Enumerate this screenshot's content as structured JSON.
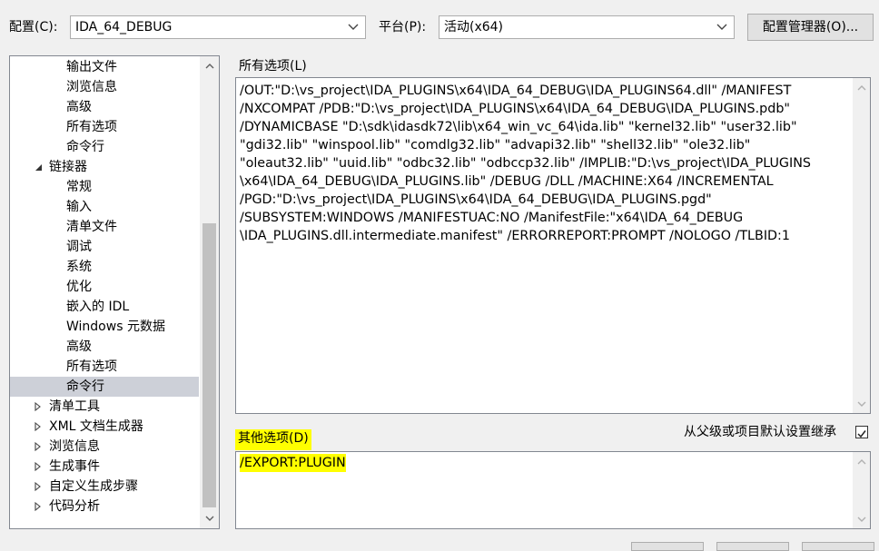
{
  "toolbar": {
    "config_label": "配置(C):",
    "config_value": "IDA_64_DEBUG",
    "platform_label": "平台(P):",
    "platform_value": "活动(x64)",
    "config_manager_button": "配置管理器(O)..."
  },
  "tree": {
    "items": [
      {
        "label": "输出文件",
        "level": 2
      },
      {
        "label": "浏览信息",
        "level": 2
      },
      {
        "label": "高级",
        "level": 2
      },
      {
        "label": "所有选项",
        "level": 2
      },
      {
        "label": "命令行",
        "level": 2
      },
      {
        "label": "链接器",
        "level": 1,
        "expander": "expanded"
      },
      {
        "label": "常规",
        "level": 2
      },
      {
        "label": "输入",
        "level": 2
      },
      {
        "label": "清单文件",
        "level": 2
      },
      {
        "label": "调试",
        "level": 2
      },
      {
        "label": "系统",
        "level": 2
      },
      {
        "label": "优化",
        "level": 2
      },
      {
        "label": "嵌入的 IDL",
        "level": 2
      },
      {
        "label": "Windows 元数据",
        "level": 2
      },
      {
        "label": "高级",
        "level": 2
      },
      {
        "label": "所有选项",
        "level": 2
      },
      {
        "label": "命令行",
        "level": 2,
        "selected": true
      },
      {
        "label": "清单工具",
        "level": 1,
        "expander": "collapsed"
      },
      {
        "label": "XML 文档生成器",
        "level": 1,
        "expander": "collapsed"
      },
      {
        "label": "浏览信息",
        "level": 1,
        "expander": "collapsed"
      },
      {
        "label": "生成事件",
        "level": 1,
        "expander": "collapsed"
      },
      {
        "label": "自定义生成步骤",
        "level": 1,
        "expander": "collapsed"
      },
      {
        "label": "代码分析",
        "level": 1,
        "expander": "collapsed"
      }
    ]
  },
  "all_options": {
    "label": "所有选项(L)",
    "lines": [
      "/OUT:\"D:\\vs_project\\IDA_PLUGINS\\x64\\IDA_64_DEBUG\\IDA_PLUGINS64.dll\" /MANIFEST",
      "/NXCOMPAT /PDB:\"D:\\vs_project\\IDA_PLUGINS\\x64\\IDA_64_DEBUG\\IDA_PLUGINS.pdb\"",
      "/DYNAMICBASE \"D:\\sdk\\idasdk72\\lib\\x64_win_vc_64\\ida.lib\" \"kernel32.lib\" \"user32.lib\"",
      "\"gdi32.lib\" \"winspool.lib\" \"comdlg32.lib\" \"advapi32.lib\" \"shell32.lib\" \"ole32.lib\"",
      "\"oleaut32.lib\" \"uuid.lib\" \"odbc32.lib\" \"odbccp32.lib\" /IMPLIB:\"D:\\vs_project\\IDA_PLUGINS",
      "\\x64\\IDA_64_DEBUG\\IDA_PLUGINS.lib\" /DEBUG /DLL /MACHINE:X64 /INCREMENTAL",
      "/PGD:\"D:\\vs_project\\IDA_PLUGINS\\x64\\IDA_64_DEBUG\\IDA_PLUGINS.pgd\"",
      "/SUBSYSTEM:WINDOWS /MANIFESTUAC:NO /ManifestFile:\"x64\\IDA_64_DEBUG",
      "\\IDA_PLUGINS.dll.intermediate.manifest\" /ERRORREPORT:PROMPT /NOLOGO /TLBID:1"
    ]
  },
  "other_options": {
    "label": "其他选项(D)",
    "value": "/EXPORT:PLUGIN",
    "inherit_label": "从父级或项目默认设置继承",
    "inherit_checked": true
  },
  "colors": {
    "highlight": "#ffff00",
    "selection": "#cdd0d8",
    "window_bg": "#f0f0f0",
    "border": "#828790"
  },
  "icons": {
    "dropdown": "chevron-down-icon",
    "expanded": "triangle-down-icon",
    "collapsed": "triangle-right-icon",
    "scroll_up": "chevron-up-icon",
    "scroll_down": "chevron-down-icon",
    "check": "check-icon"
  }
}
